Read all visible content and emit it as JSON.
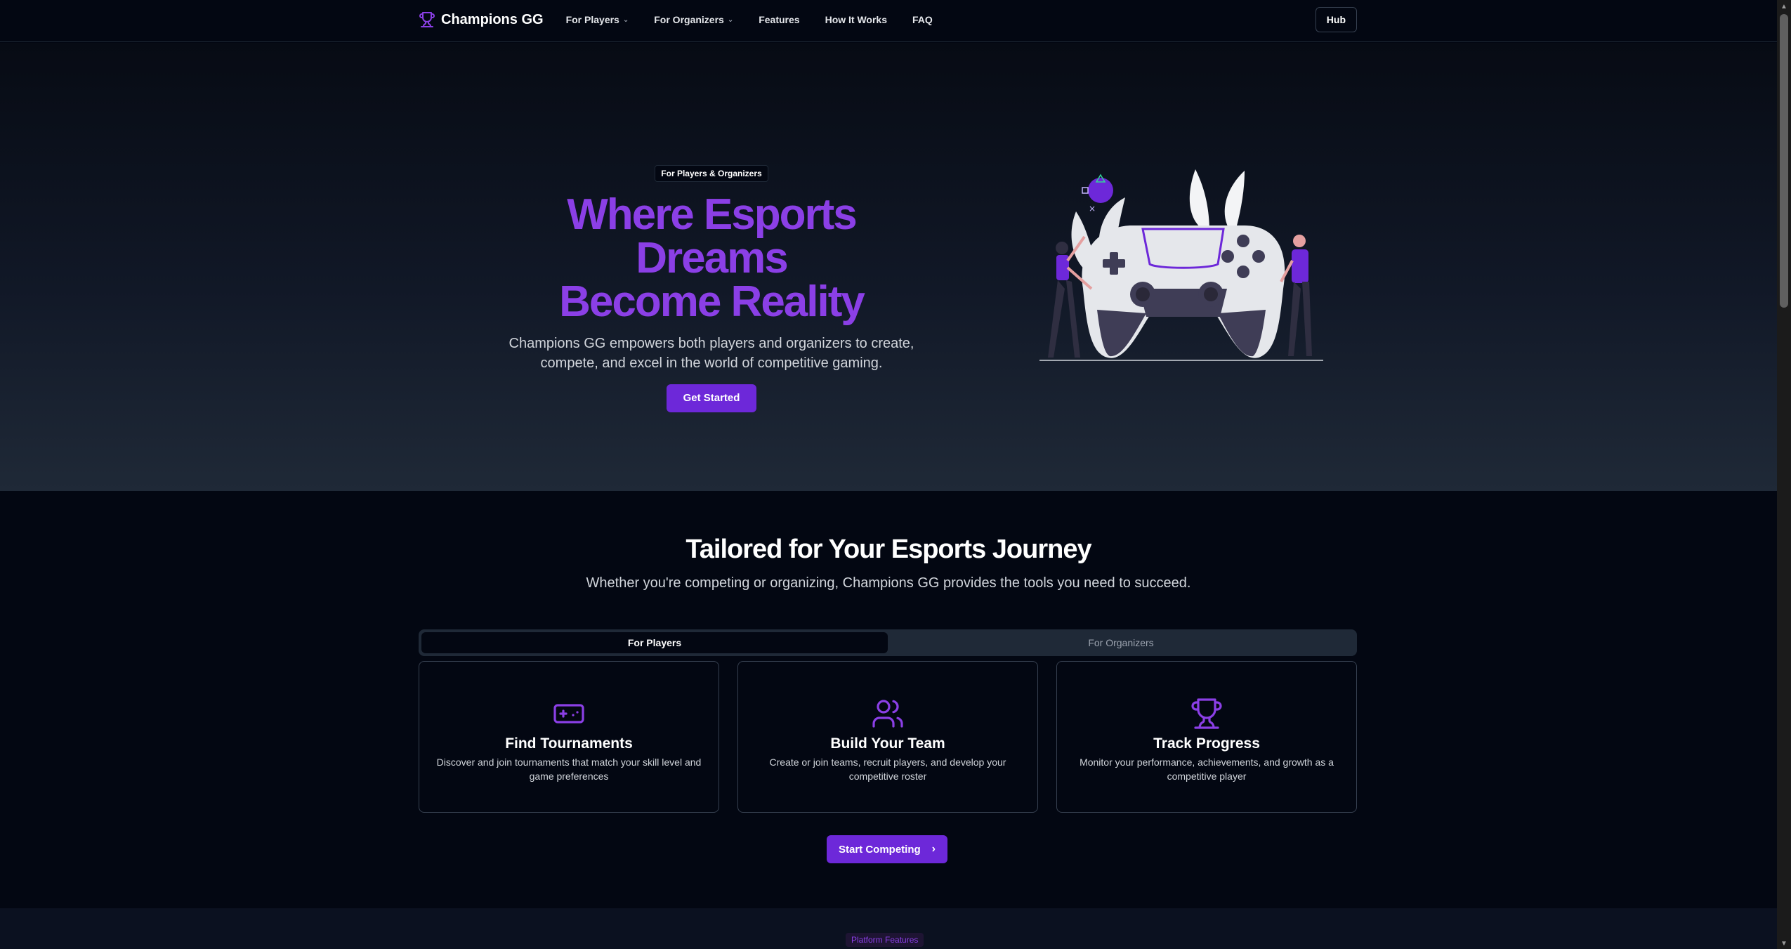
{
  "nav": {
    "brand": "Champions GG",
    "links": [
      {
        "label": "For Players",
        "dropdown": true
      },
      {
        "label": "For Organizers",
        "dropdown": true
      },
      {
        "label": "Features",
        "dropdown": false
      },
      {
        "label": "How It Works",
        "dropdown": false
      },
      {
        "label": "FAQ",
        "dropdown": false
      }
    ],
    "hub_label": "Hub"
  },
  "hero": {
    "badge": "For Players & Organizers",
    "title_line1": "Where Esports Dreams",
    "title_line2": "Become Reality",
    "subtitle": "Champions GG empowers both players and organizers to create, compete, and excel in the world of competitive gaming.",
    "cta": "Get Started"
  },
  "tailored": {
    "title": "Tailored for Your Esports Journey",
    "subtitle": "Whether you're competing or organizing, Champions GG provides the tools you need to succeed.",
    "tabs": [
      {
        "label": "For Players",
        "active": true
      },
      {
        "label": "For Organizers",
        "active": false
      }
    ],
    "cards": [
      {
        "icon": "gamepad-icon",
        "title": "Find Tournaments",
        "desc": "Discover and join tournaments that match your skill level and game preferences"
      },
      {
        "icon": "users-icon",
        "title": "Build Your Team",
        "desc": "Create or join teams, recruit players, and develop your competitive roster"
      },
      {
        "icon": "trophy-icon",
        "title": "Track Progress",
        "desc": "Monitor your performance, achievements, and growth as a competitive player"
      }
    ],
    "cta": "Start Competing"
  },
  "next_section": {
    "badge": "Platform Features"
  },
  "colors": {
    "accent": "#8b3fe6",
    "button": "#6d28d9",
    "background": "#030712"
  }
}
